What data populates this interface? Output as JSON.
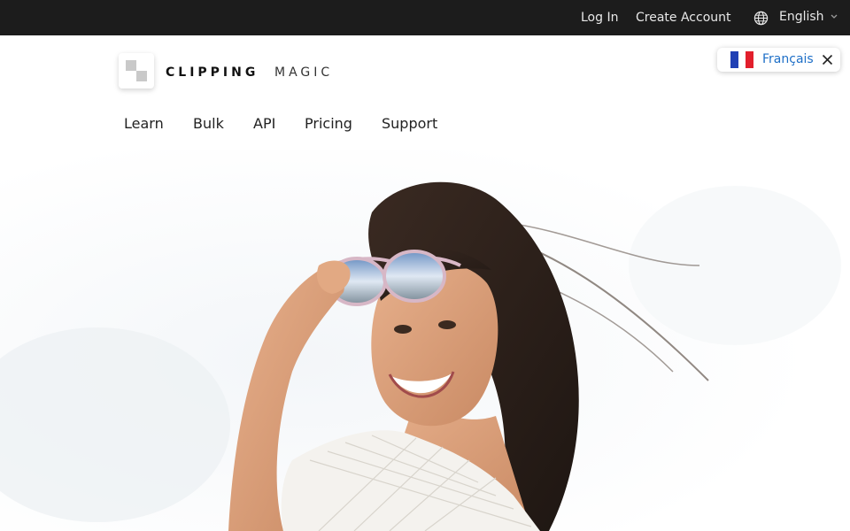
{
  "topbar": {
    "login": "Log In",
    "create_account": "Create Account",
    "language": "English",
    "icons": {
      "globe": "globe-icon",
      "chevron": "chevron-down-icon"
    }
  },
  "logo": {
    "word1": "CLIPPING",
    "word2": "MAGIC"
  },
  "language_suggestion": {
    "label": "Français",
    "flag": "france-flag",
    "close_icon": "close-icon"
  },
  "nav": {
    "items": [
      "Learn",
      "Bulk",
      "API",
      "Pricing",
      "Support"
    ]
  },
  "hero": {
    "image": "woman-with-sunglasses-photo"
  },
  "colors": {
    "topbar_bg": "#1c1c1c",
    "link_blue": "#1e6fc7",
    "text": "#222222"
  }
}
